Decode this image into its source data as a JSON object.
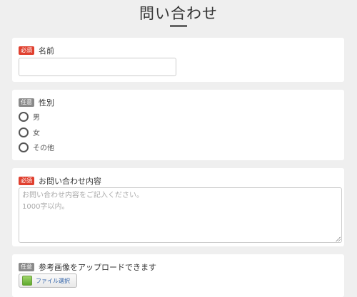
{
  "page": {
    "title": "問い合わせ"
  },
  "badges": {
    "required": "必須",
    "optional": "任意"
  },
  "name_field": {
    "label": "名前",
    "value": "",
    "placeholder": ""
  },
  "gender_field": {
    "label": "性別",
    "options": [
      "男",
      "女",
      "その他"
    ]
  },
  "inquiry_field": {
    "label": "お問い合わせ内容",
    "placeholder_lines": [
      "お問い合わせ内容をご記入ください。",
      "1000字以内。"
    ]
  },
  "image_field": {
    "label": "参考画像をアップロードできます",
    "button_label": "ファイル選択"
  },
  "colors": {
    "background": "#efefef",
    "required_badge": "#e0402f",
    "optional_badge": "#8a8a8a"
  }
}
